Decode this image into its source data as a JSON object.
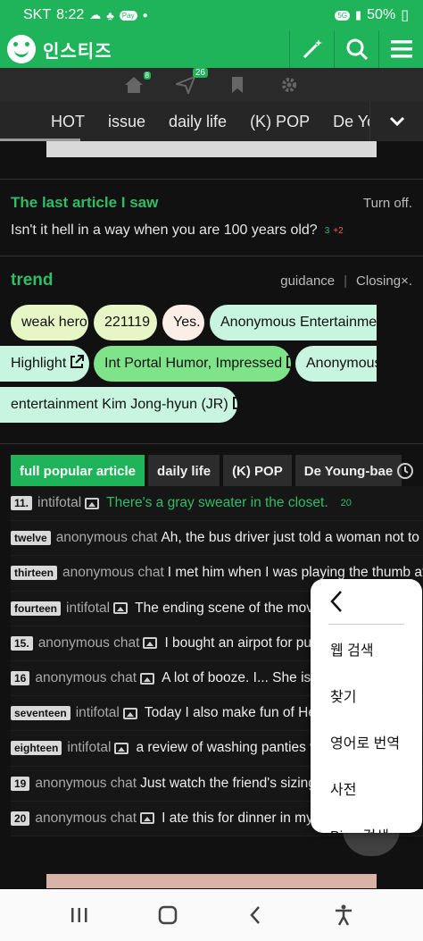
{
  "status": {
    "carrier": "SKT",
    "time": "8:22",
    "pay": "Pay",
    "network": "5G",
    "battery": "50%"
  },
  "app": {
    "title": "인스티즈"
  },
  "iconrow": {
    "send_badge": "26",
    "home_badge": "8"
  },
  "categories": [
    "HOT",
    "issue",
    "daily life",
    "(K) POP",
    "De Your"
  ],
  "last_article": {
    "title": "The last article I saw",
    "turn_off": "Turn off.",
    "text": "Isn't it hell in a way when you are 100 years old?",
    "comments": "3",
    "plus": "+2"
  },
  "trend": {
    "title": "trend",
    "guidance": "guidance",
    "closing": "Closing×.",
    "chips": [
      {
        "label": "weak hero",
        "color": "#e6f7c5"
      },
      {
        "label": "221119",
        "color": "#e6f7c5"
      },
      {
        "label": "Yes.",
        "color": "#fbeee6"
      },
      {
        "label": "Anonymous Entertainment",
        "color": "#c8f5df"
      },
      {
        "label": "Highlight",
        "color": "#c8f5df"
      },
      {
        "label": "Int Portal Humor, Impressed",
        "color": "#7fe38a"
      },
      {
        "label": "Anonymous",
        "color": "#c8f5df"
      },
      {
        "label": "entertainment Kim Jong-hyun (JR)",
        "color": "#c8f5df"
      }
    ]
  },
  "popular": {
    "tabs": [
      "full popular article",
      "daily life",
      "(K) POP",
      "De Young-bae"
    ],
    "rows": [
      {
        "rank": "11.",
        "src": "intifotal",
        "img": true,
        "title": "There's a gray sweater in the closet.",
        "count": "20",
        "green": true
      },
      {
        "rank": "twelve",
        "src": "anonymous chat",
        "img": false,
        "title": "Ah, the bus driver just told a woman not to twist",
        "count": "",
        "green": false
      },
      {
        "rank": "thirteen",
        "src": "anonymous chat",
        "img": false,
        "title": "I met him when I was playing the thumb after",
        "count": "",
        "green": false
      },
      {
        "rank": "fourteen",
        "src": "intifotal",
        "img": true,
        "title": "The ending scene of the movie J",
        "count": "",
        "green": false
      },
      {
        "rank": "15.",
        "src": "anonymous chat",
        "img": true,
        "title": "I bought an airpot for puppies",
        "count": "",
        "green": false
      },
      {
        "rank": "16",
        "src": "anonymous chat",
        "img": true,
        "title": "A lot of booze. I... She is read",
        "count": "",
        "green": false
      },
      {
        "rank": "seventeen",
        "src": "intifotal",
        "img": true,
        "title": "Today I also make fun of Hee D",
        "count": "",
        "green": false
      },
      {
        "rank": "eighteen",
        "src": "intifotal",
        "img": true,
        "title": "a review of washing panties with",
        "count": "",
        "green": false
      },
      {
        "rank": "19",
        "src": "anonymous chat",
        "img": false,
        "title": "Just watch the friend's sizing.",
        "count": "",
        "green": false
      },
      {
        "rank": "20",
        "src": "anonymous chat",
        "img": true,
        "title": "I ate this for dinner in my hou",
        "count": "",
        "green": false
      }
    ]
  },
  "popup": {
    "items": [
      "웹 검색",
      "찾기",
      "영어로 번역",
      "사전",
      "Bing 검색"
    ]
  },
  "colors": {
    "brand": "#1fb35a",
    "accent_text": "#2fbd66",
    "red": "#ff5c5c"
  }
}
